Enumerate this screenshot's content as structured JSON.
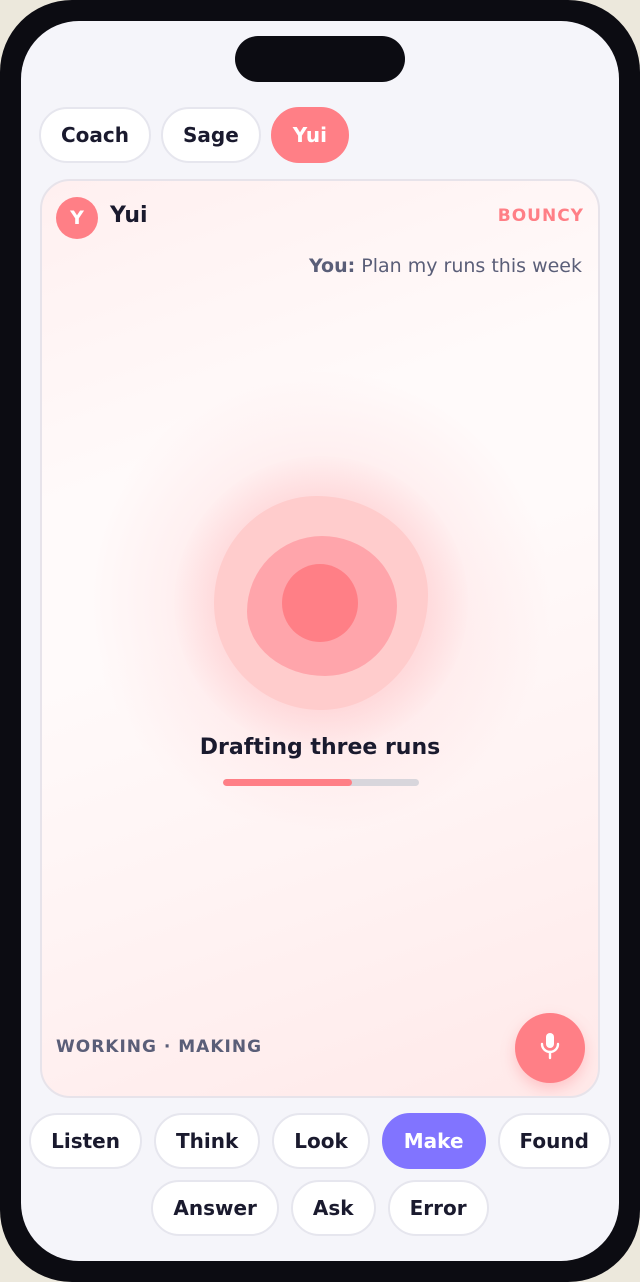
{
  "personas": [
    "Coach",
    "Sage",
    "Yui"
  ],
  "agent": {
    "initial": "Y",
    "name": "Yui",
    "mood": "BOUNCY"
  },
  "user_message": {
    "prefix": "You:",
    "text": " Plan my runs this week"
  },
  "status": {
    "text": "Drafting three runs",
    "progress": 0.66
  },
  "mode": "WORKING · MAKING",
  "states_row1": [
    "Listen",
    "Think",
    "Look",
    "Make",
    "Found"
  ],
  "states_row2": [
    "Answer",
    "Ask",
    "Error"
  ],
  "colors": {
    "accent": "#ff7f86",
    "selected_state": "#8174ff"
  },
  "icons": {
    "mic": "microphone-icon"
  }
}
